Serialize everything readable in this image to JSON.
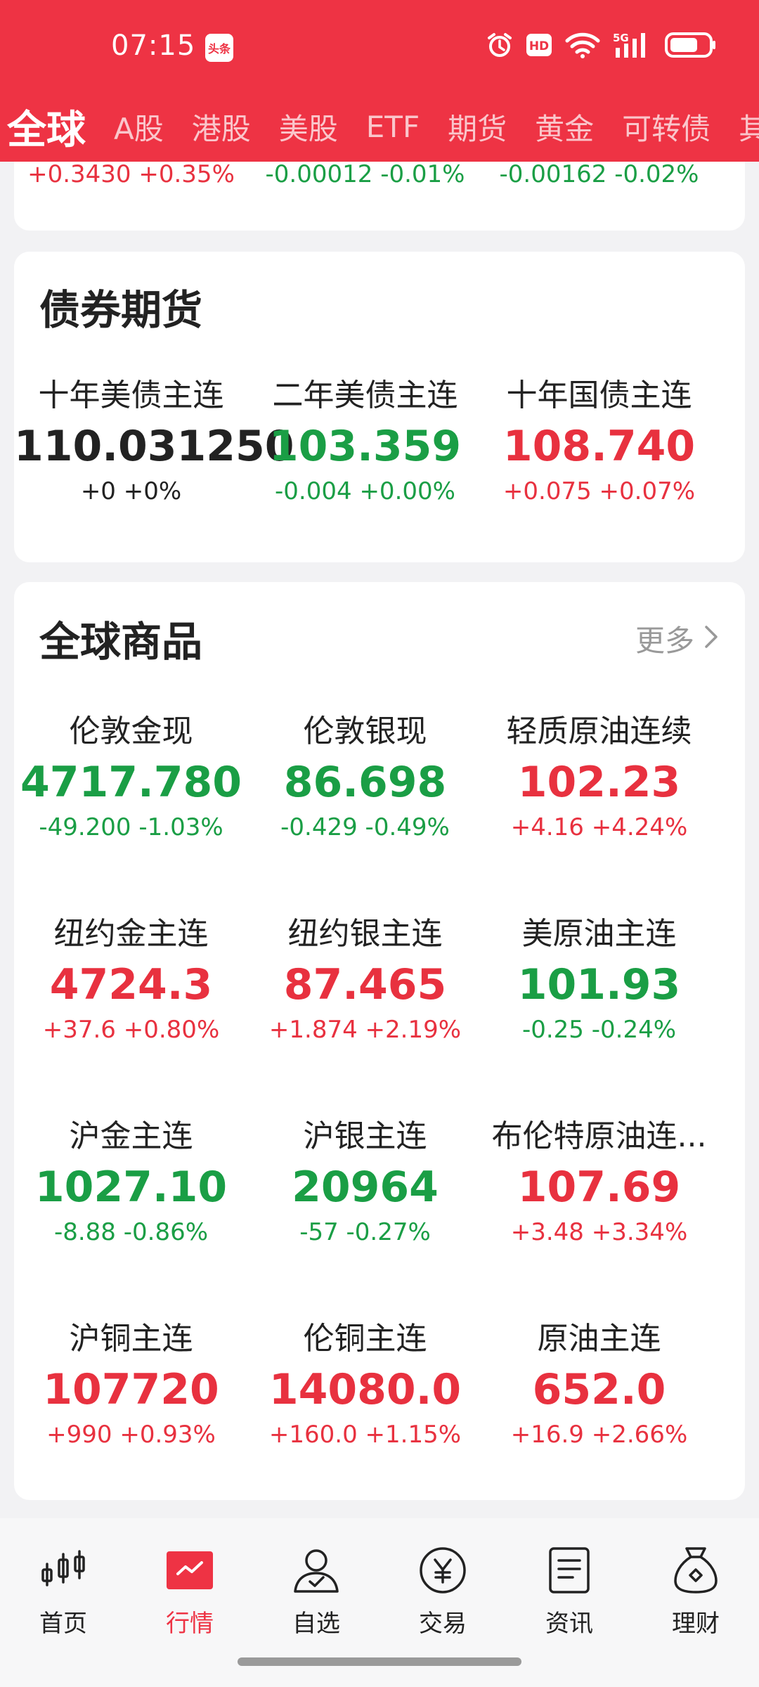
{
  "status_bar": {
    "time": "07:15",
    "app_badge": "头条",
    "network_label": "5G",
    "hd_label": "HD"
  },
  "tabs": [
    {
      "label": "全球",
      "active": true
    },
    {
      "label": "A股"
    },
    {
      "label": "港股"
    },
    {
      "label": "美股"
    },
    {
      "label": "ETF"
    },
    {
      "label": "期货"
    },
    {
      "label": "黄金"
    },
    {
      "label": "可转债"
    },
    {
      "label": "其他"
    }
  ],
  "partial_row": [
    {
      "change": "+0.3430 +0.35%",
      "trend": "up"
    },
    {
      "change": "-0.00012 -0.01%",
      "trend": "down"
    },
    {
      "change": "-0.00162 -0.02%",
      "trend": "down"
    }
  ],
  "bond_futures": {
    "title": "债券期货",
    "items": [
      {
        "name": "十年美债主连",
        "price": "110.031250",
        "change": "+0 +0%",
        "trend": "flat"
      },
      {
        "name": "二年美债主连",
        "price": "103.359",
        "change": "-0.004 +0.00%",
        "trend": "down"
      },
      {
        "name": "十年国债主连",
        "price": "108.740",
        "change": "+0.075 +0.07%",
        "trend": "up"
      }
    ]
  },
  "global_commodities": {
    "title": "全球商品",
    "more_label": "更多",
    "rows": [
      [
        {
          "name": "伦敦金现",
          "price": "4717.780",
          "change": "-49.200 -1.03%",
          "trend": "down"
        },
        {
          "name": "伦敦银现",
          "price": "86.698",
          "change": "-0.429 -0.49%",
          "trend": "down"
        },
        {
          "name": "轻质原油连续",
          "price": "102.23",
          "change": "+4.16 +4.24%",
          "trend": "up"
        }
      ],
      [
        {
          "name": "纽约金主连",
          "price": "4724.3",
          "change": "+37.6 +0.80%",
          "trend": "up"
        },
        {
          "name": "纽约银主连",
          "price": "87.465",
          "change": "+1.874 +2.19%",
          "trend": "up"
        },
        {
          "name": "美原油主连",
          "price": "101.93",
          "change": "-0.25 -0.24%",
          "trend": "down"
        }
      ],
      [
        {
          "name": "沪金主连",
          "price": "1027.10",
          "change": "-8.88 -0.86%",
          "trend": "down"
        },
        {
          "name": "沪银主连",
          "price": "20964",
          "change": "-57 -0.27%",
          "trend": "down"
        },
        {
          "name": "布伦特原油连...",
          "price": "107.69",
          "change": "+3.48 +3.34%",
          "trend": "up"
        }
      ],
      [
        {
          "name": "沪铜主连",
          "price": "107720",
          "change": "+990 +0.93%",
          "trend": "up"
        },
        {
          "name": "伦铜主连",
          "price": "14080.0",
          "change": "+160.0 +1.15%",
          "trend": "up"
        },
        {
          "name": "原油主连",
          "price": "652.0",
          "change": "+16.9 +2.66%",
          "trend": "up"
        }
      ]
    ]
  },
  "bottom_nav": [
    {
      "label": "首页",
      "icon": "candlestick-icon"
    },
    {
      "label": "行情",
      "icon": "chart-trend-icon",
      "active": true
    },
    {
      "label": "自选",
      "icon": "user-check-icon"
    },
    {
      "label": "交易",
      "icon": "yen-circle-icon"
    },
    {
      "label": "资讯",
      "icon": "document-icon"
    },
    {
      "label": "理财",
      "icon": "money-bag-icon"
    }
  ],
  "colors": {
    "brand_red": "#ee3344",
    "up": "#e8313f",
    "down": "#1a9e45"
  }
}
